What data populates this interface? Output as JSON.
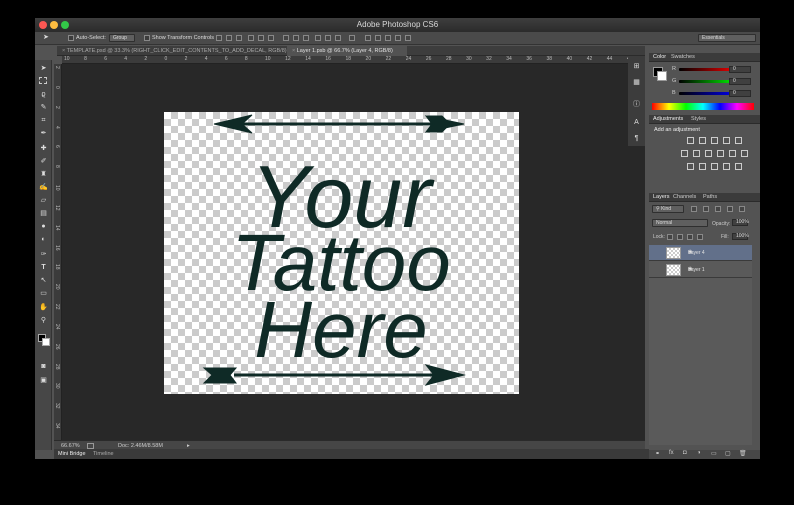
{
  "app": {
    "title": "Adobe Photoshop CS6"
  },
  "options_bar": {
    "auto_select_label": "Auto-Select:",
    "auto_select_value": "Group",
    "transform_label": "Show Transform Controls",
    "workspace": "Essentials"
  },
  "tabs": [
    {
      "label": "TEMPLATE.psd @ 33.3% (RIGHT_CLICK_EDIT_CONTENTS_TO_ADD_DECAL, RGB/8)"
    },
    {
      "label": "Layer 1.psb @ 66.7% (Layer 4, RGB/8)"
    }
  ],
  "ruler_h": [
    "10",
    "8",
    "6",
    "4",
    "2",
    "0",
    "2",
    "4",
    "6",
    "8",
    "10",
    "12",
    "14",
    "16",
    "18",
    "20",
    "22",
    "24",
    "26",
    "28",
    "30",
    "32",
    "34",
    "36",
    "38",
    "40",
    "42",
    "44",
    "46"
  ],
  "ruler_v": [
    "2",
    "0",
    "2",
    "4",
    "6",
    "8",
    "10",
    "12",
    "14",
    "16",
    "18",
    "20",
    "22",
    "24",
    "26",
    "28",
    "30",
    "32",
    "34"
  ],
  "artwork": {
    "line1": "Your",
    "line2": "Tattoo",
    "line3": "Here",
    "color": "#0f2a26"
  },
  "status": {
    "zoom": "66.67%",
    "doc": "Doc: 2.46M/8.58M"
  },
  "bottom_tabs": {
    "mini_bridge": "Mini Bridge",
    "timeline": "Timeline"
  },
  "color_panel": {
    "tab_color": "Color",
    "tab_swatches": "Swatches",
    "r_label": "R",
    "g_label": "G",
    "b_label": "B",
    "r": "0",
    "g": "0",
    "b": "0"
  },
  "adjustments": {
    "tab_adjustments": "Adjustments",
    "tab_styles": "Styles",
    "add_label": "Add an adjustment"
  },
  "layers_panel": {
    "tab_layers": "Layers",
    "tab_channels": "Channels",
    "tab_paths": "Paths",
    "filter_kind": "Kind",
    "blend_mode": "Normal",
    "opacity_label": "Opacity:",
    "opacity": "100%",
    "lock_label": "Lock:",
    "fill_label": "Fill:",
    "fill": "100%",
    "layers": [
      {
        "name": "Layer 4",
        "selected": true
      },
      {
        "name": "Layer 1",
        "selected": false
      }
    ]
  }
}
